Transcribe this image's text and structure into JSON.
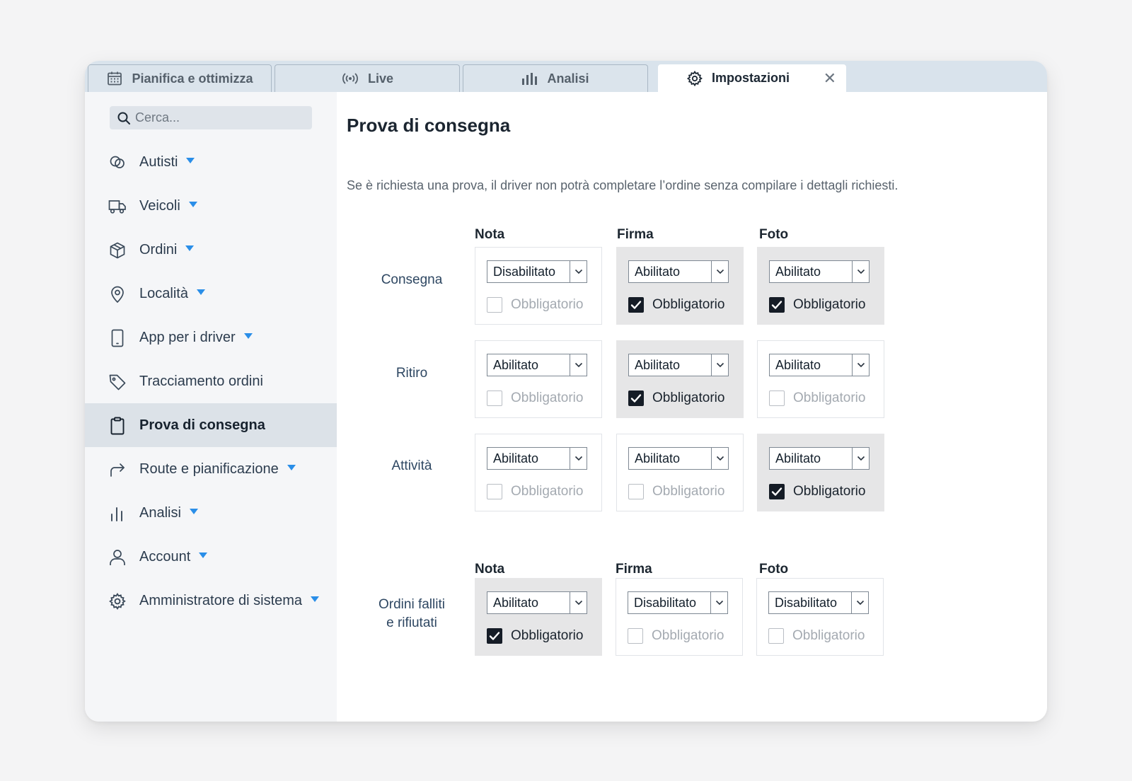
{
  "tabs": [
    {
      "label": "Pianifica e ottimizza",
      "icon": "calendar-icon"
    },
    {
      "label": "Live",
      "icon": "broadcast-icon"
    },
    {
      "label": "Analisi",
      "icon": "bar-chart-icon"
    },
    {
      "label": "Impostazioni",
      "icon": "gear-icon",
      "active": true,
      "close": "✕"
    }
  ],
  "sidebar": {
    "search_placeholder": "Cerca...",
    "items": [
      {
        "label": "Autisti",
        "icon": "drivers-icon",
        "has_caret": true
      },
      {
        "label": "Veicoli",
        "icon": "truck-icon",
        "has_caret": true
      },
      {
        "label": "Ordini",
        "icon": "box-icon",
        "has_caret": true
      },
      {
        "label": "Località",
        "icon": "map-pin-icon",
        "has_caret": true
      },
      {
        "label": "App per i driver",
        "icon": "phone-icon",
        "has_caret": true
      },
      {
        "label": "Tracciamento ordini",
        "icon": "tag-icon",
        "has_caret": false
      },
      {
        "label": "Prova di consegna",
        "icon": "clipboard-icon",
        "has_caret": false,
        "active": true
      },
      {
        "label": "Route e pianificazione",
        "icon": "route-arrow-icon",
        "has_caret": true
      },
      {
        "label": "Analisi",
        "icon": "bar-chart-icon",
        "has_caret": true
      },
      {
        "label": "Account",
        "icon": "user-icon",
        "has_caret": true
      },
      {
        "label": "Amministratore di sistema",
        "icon": "gear-icon",
        "has_caret": true
      }
    ]
  },
  "main": {
    "title": "Prova di consegna",
    "description": "Se è richiesta una prova, il driver non potrà completare l’ordine senza compilare i dettagli richiesti.",
    "columns": [
      "Nota",
      "Firma",
      "Foto"
    ],
    "required_label": "Obbligatorio",
    "rows": [
      {
        "label": "Consegna",
        "cells": [
          {
            "value": "Disabilitato",
            "required": false
          },
          {
            "value": "Abilitato",
            "required": true
          },
          {
            "value": "Abilitato",
            "required": true
          }
        ]
      },
      {
        "label": "Ritiro",
        "cells": [
          {
            "value": "Abilitato",
            "required": false
          },
          {
            "value": "Abilitato",
            "required": true
          },
          {
            "value": "Abilitato",
            "required": false
          }
        ]
      },
      {
        "label": "Attività",
        "cells": [
          {
            "value": "Abilitato",
            "required": false
          },
          {
            "value": "Abilitato",
            "required": false
          },
          {
            "value": "Abilitato",
            "required": true
          }
        ]
      }
    ],
    "failed_section": {
      "columns": [
        "Nota",
        "Firma",
        "Foto"
      ],
      "label_line1": "Ordini falliti",
      "label_line2": "e rifiutati",
      "cells": [
        {
          "value": "Abilitato",
          "required": true
        },
        {
          "value": "Disabilitato",
          "required": false
        },
        {
          "value": "Disabilitato",
          "required": false
        }
      ]
    }
  }
}
